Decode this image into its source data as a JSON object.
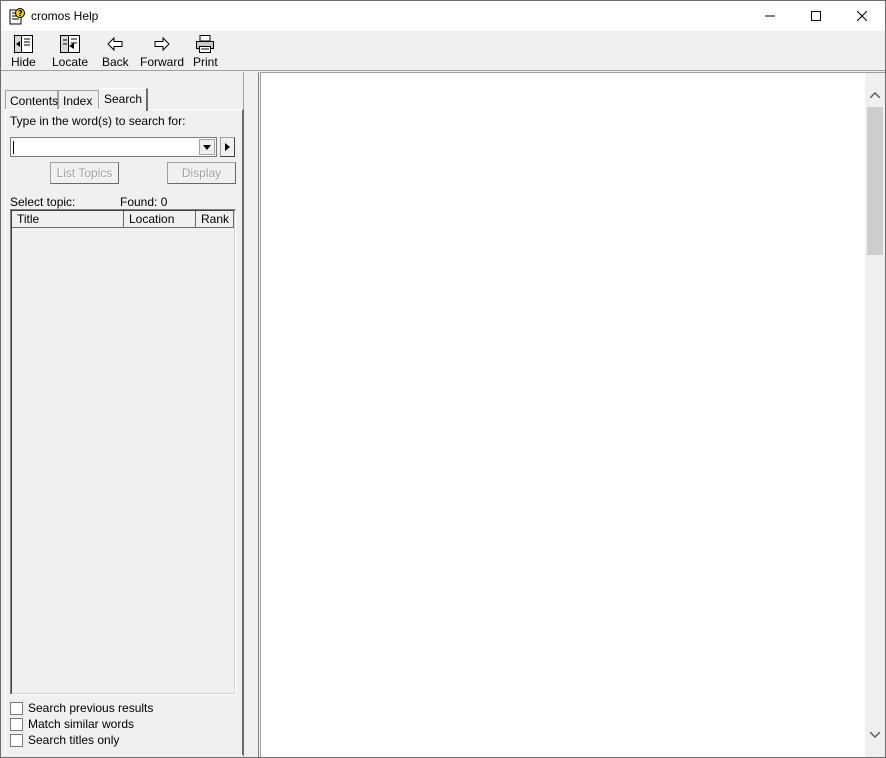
{
  "window": {
    "title": "cromos Help"
  },
  "toolbar": {
    "hide_label": "Hide",
    "locate_label": "Locate",
    "back_label": "Back",
    "forward_label": "Forward",
    "print_label": "Print"
  },
  "tabs": {
    "contents_label": "Contents",
    "index_label": "Index",
    "search_label": "Search",
    "active": "Search"
  },
  "search": {
    "prompt": "Type in the word(s) to search for:",
    "query": "",
    "list_topics_label": "List Topics",
    "display_label": "Display",
    "select_topic_label": "Select topic:",
    "found_label": "Found: 0",
    "columns": [
      "Title",
      "Location",
      "Rank"
    ],
    "results": [],
    "options": [
      {
        "label": "Search previous results",
        "checked": false
      },
      {
        "label": "Match similar words",
        "checked": false
      },
      {
        "label": "Search titles only",
        "checked": false
      }
    ]
  },
  "icons": {
    "app": "help-book-icon",
    "hide": "hide-pane-icon",
    "locate": "locate-icon",
    "back": "back-arrow-icon",
    "forward": "forward-arrow-icon",
    "print": "printer-icon"
  }
}
